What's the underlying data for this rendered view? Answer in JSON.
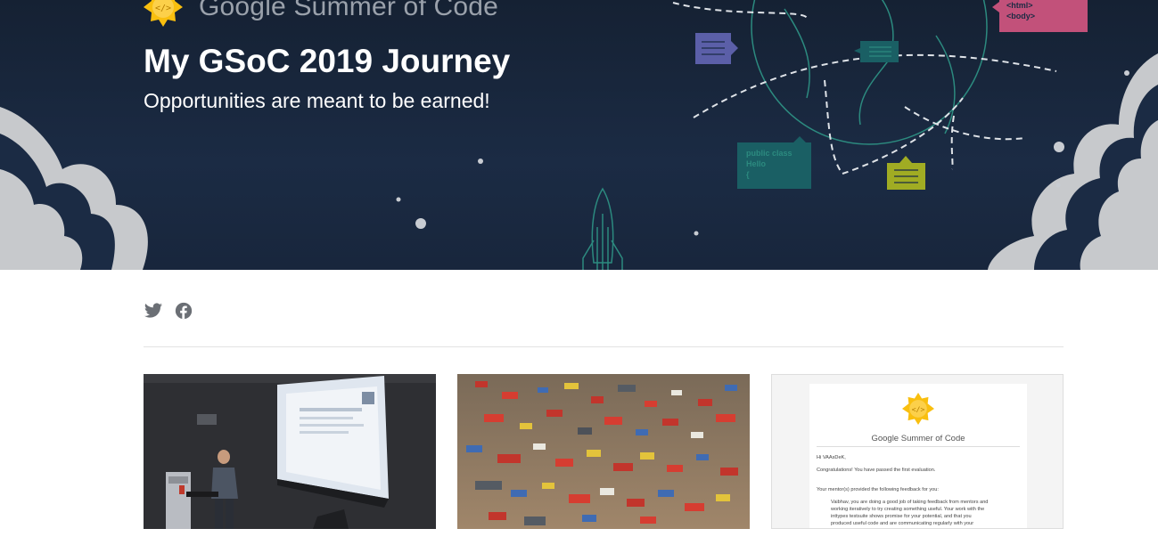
{
  "header": {
    "brand_name": "Google Summer of Code",
    "title": "My GSoC 2019 Journey",
    "tagline": "Opportunities are meant to be earned!",
    "illustration_snippets": {
      "html_tag": "<html>",
      "body_tag": "<body>",
      "code_line_1": "public class",
      "code_line_2": "Hello",
      "code_line_3": "{"
    }
  },
  "social": {
    "icons": [
      "twitter-icon",
      "facebook-icon"
    ]
  },
  "posts": [
    {
      "image": "speaker-presenting-photo"
    },
    {
      "image": "scattered-lego-bricks-photo"
    },
    {
      "image": "gsoc-evaluation-email-screenshot",
      "email": {
        "brand": "Google Summer of Code",
        "greeting": "Hi VAAsDeK,",
        "congrats": "Congratulations! You have passed the first evaluation.",
        "feedback_intro": "Your mentor(s) provided the following feedback for you:",
        "feedback_1": "Vaibhav, you are doing a good job of taking feedback from mentors and",
        "feedback_2": "working iteratively to try creating something useful. Your work with the",
        "feedback_3": "inttypes testsuite shows promise for your potential, and that you",
        "feedback_4": "produced useful code and are communicating regularly with your"
      }
    }
  ],
  "colors": {
    "hero_bg": "#18263c",
    "hero_line": "#2c8a7f",
    "gsoc_yellow": "#f9bf0f",
    "accent_pink": "#c2517a",
    "accent_purple": "#5b5fa8",
    "accent_teal": "#1a5f64",
    "accent_olive": "#a0ac23"
  }
}
